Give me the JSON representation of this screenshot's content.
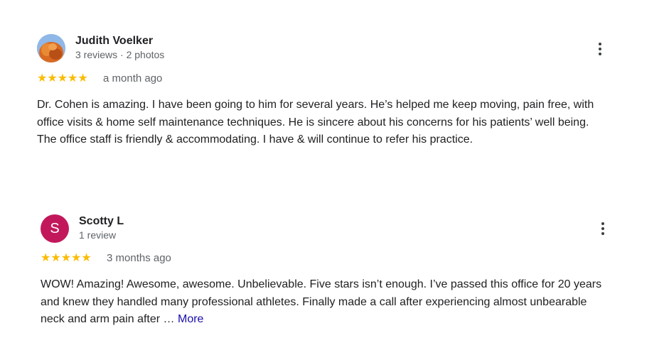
{
  "reviews": [
    {
      "author": "Judith Voelker",
      "meta": "3 reviews · 2 photos",
      "avatar": {
        "type": "photo",
        "icon": "profile-photo"
      },
      "rating": 5,
      "stars": "★★★★★",
      "date": "a month ago",
      "text": "Dr. Cohen is amazing. I have been going to him for several years. He’s helped me keep moving, pain free, with office visits & home self maintenance techniques. He is sincere about his concerns for his patients’ well being. The office staff is friendly & accommodating. I have & will continue to refer his practice.",
      "more_label": ""
    },
    {
      "author": "Scotty L",
      "meta": "1 review",
      "avatar": {
        "type": "letter",
        "letter": "S",
        "color": "#c2185b"
      },
      "rating": 5,
      "stars": "★★★★★",
      "date": "3 months ago",
      "text": "WOW! Amazing! Awesome, awesome. Unbelievable. Five stars isn’t enough. I’ve passed this office for 20 years and knew they handled many professional athletes. Finally made a call after experiencing almost unbearable neck and arm pain after … ",
      "more_label": "More"
    }
  ],
  "colors": {
    "star": "#fbbc04",
    "link": "#1a0dab",
    "secondary_text": "#5f6368",
    "avatar_s": "#c2185b"
  }
}
